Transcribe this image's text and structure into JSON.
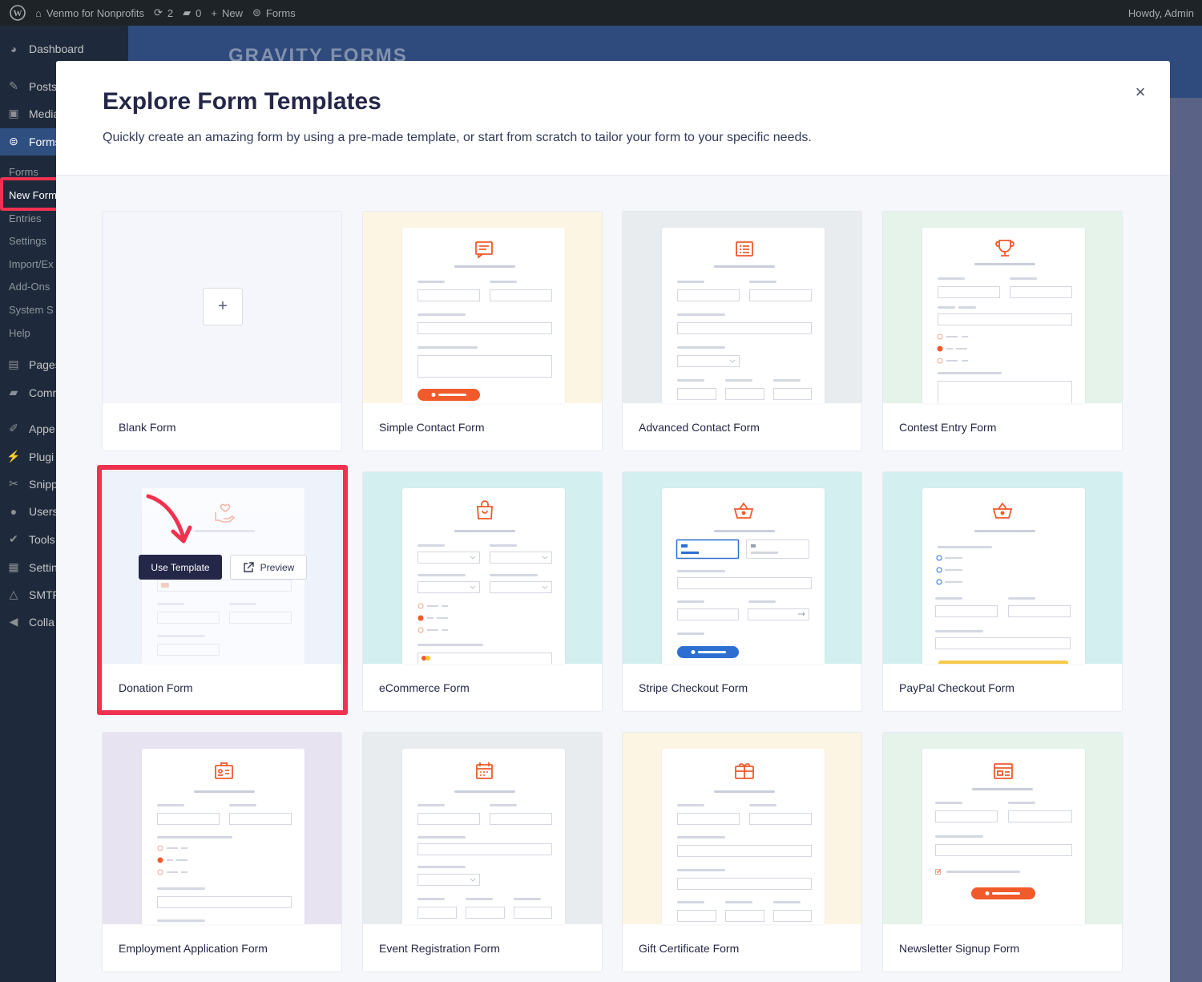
{
  "adminbar": {
    "site": "Venmo for Nonprofits",
    "updates": "2",
    "comments": "0",
    "new_label": "New",
    "forms_label": "Forms",
    "howdy": "Howdy, Admin"
  },
  "sidebar": {
    "dashboard": "Dashboard",
    "posts": "Posts",
    "media": "Media",
    "forms": "Forms",
    "sub": [
      "Forms",
      "New Form",
      "Entries",
      "Settings",
      "Import/Ex",
      "Add-Ons",
      "System S",
      "Help"
    ],
    "pages": "Pages",
    "comments": "Comm",
    "appearance": "Appe",
    "plugins": "Plugi",
    "snippets": "Snipp",
    "users": "Users",
    "tools": "Tools",
    "settings": "Settin",
    "smtp": "SMTP",
    "collapse": "Colla"
  },
  "header": {
    "logo_text": "GRAVITY FORMS"
  },
  "modal": {
    "title": "Explore Form Templates",
    "subtitle": "Quickly create an amazing form by using a pre-made template, or start from scratch to tailor your form to your specific needs.",
    "close": "×",
    "use_template": "Use Template",
    "preview": "Preview"
  },
  "templates": [
    {
      "name": "Blank Form",
      "bg": "#f4f6fb"
    },
    {
      "name": "Simple Contact Form",
      "bg": "#fdf5e4"
    },
    {
      "name": "Advanced Contact Form",
      "bg": "#e8ecef"
    },
    {
      "name": "Contest Entry Form",
      "bg": "#e5f3ea"
    },
    {
      "name": "Donation Form",
      "bg": "#eef2fb"
    },
    {
      "name": "eCommerce Form",
      "bg": "#d4efef"
    },
    {
      "name": "Stripe Checkout Form",
      "bg": "#d4efef"
    },
    {
      "name": "PayPal Checkout Form",
      "bg": "#d4efef"
    },
    {
      "name": "Employment Application Form",
      "bg": "#e8e3f1"
    },
    {
      "name": "Event Registration Form",
      "bg": "#e8ecef"
    },
    {
      "name": "Gift Certificate Form",
      "bg": "#fdf5e4"
    },
    {
      "name": "Newsletter Signup Form",
      "bg": "#e5f3ea"
    }
  ],
  "colors": {
    "accent": "#f15a2b",
    "stripe_blue": "#2c6fd1",
    "highlight": "#f0314f",
    "navy": "#242748"
  }
}
